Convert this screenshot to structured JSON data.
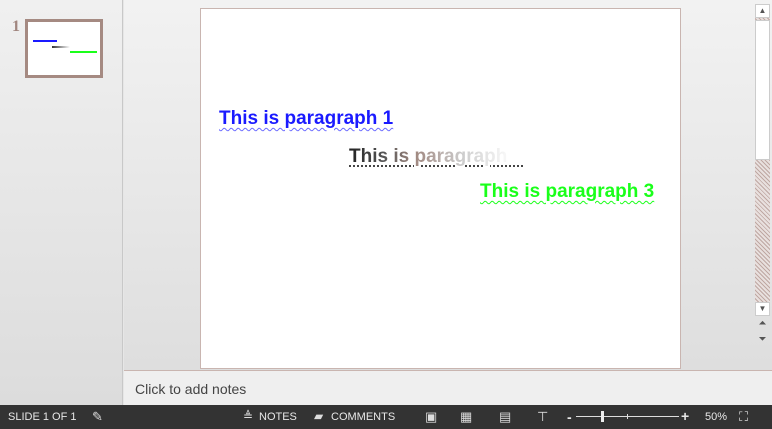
{
  "thumbnails": {
    "slide_number": "1"
  },
  "slide": {
    "paragraphs": [
      {
        "text": "This is paragraph 1",
        "color": "#1a1aff"
      },
      {
        "text": "This is paragraph 2",
        "color": "gradient"
      },
      {
        "text": "This is paragraph 3",
        "color": "#1aff1a"
      }
    ]
  },
  "notes": {
    "placeholder": "Click to add notes"
  },
  "status": {
    "slide_indicator": "SLIDE 1 OF 1",
    "notes_label": "NOTES",
    "comments_label": "COMMENTS",
    "zoom_minus": "-",
    "zoom_plus": "+",
    "zoom_level": "50%",
    "zoom_percent": 50
  }
}
